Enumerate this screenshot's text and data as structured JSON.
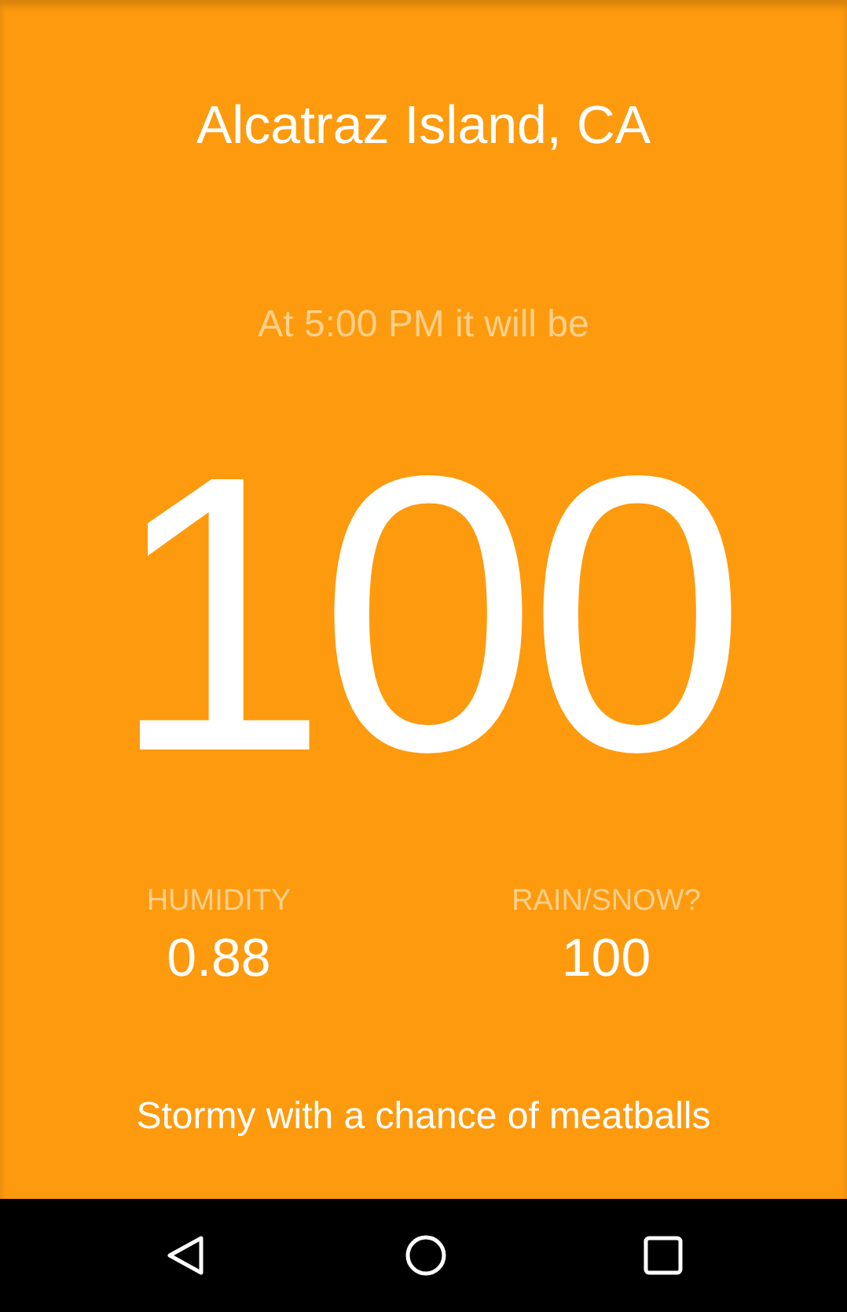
{
  "location": "Alcatraz Island, CA",
  "forecast_intro": "At 5:00 PM it will be",
  "temperature": "100",
  "stats": [
    {
      "label": "HUMIDITY",
      "value": "0.88"
    },
    {
      "label": "RAIN/SNOW?",
      "value": "100"
    }
  ],
  "summary": "Stormy with a chance of meatballs"
}
